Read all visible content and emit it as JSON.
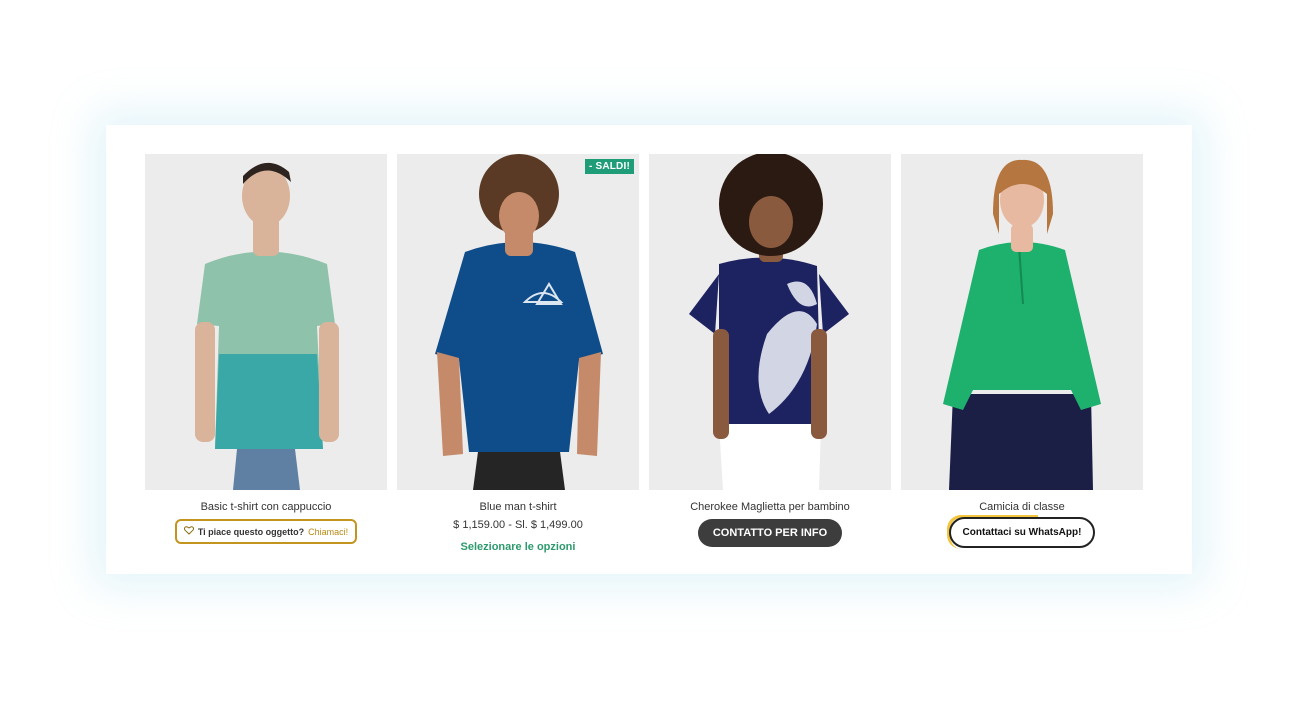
{
  "products": [
    {
      "title": "Basic t-shirt con cappuccio",
      "photo": "man-mint-teal-tshirt",
      "like_question": "Ti piace questo oggetto?",
      "like_call": "Chiamaci!",
      "like_icon": "heart-outline-icon",
      "accent": "#c3951e"
    },
    {
      "title": "Blue man t-shirt",
      "photo": "man-blue-adidas-tshirt",
      "badge": "- SALDI!",
      "price": "$ 1,159.00 - Sl. $ 1,499.00",
      "options_link": "Selezionare le opzioni",
      "accent": "#1f9d79"
    },
    {
      "title": "Cherokee Maglietta per bambino",
      "photo": "woman-navy-floral-top",
      "button": "CONTATTO PER INFO",
      "accent": "#3d3d3d"
    },
    {
      "title": "Camicia di classe",
      "photo": "woman-green-blouse",
      "button": "Contattaci su WhatsApp!",
      "accent": "#f2c53d"
    }
  ]
}
